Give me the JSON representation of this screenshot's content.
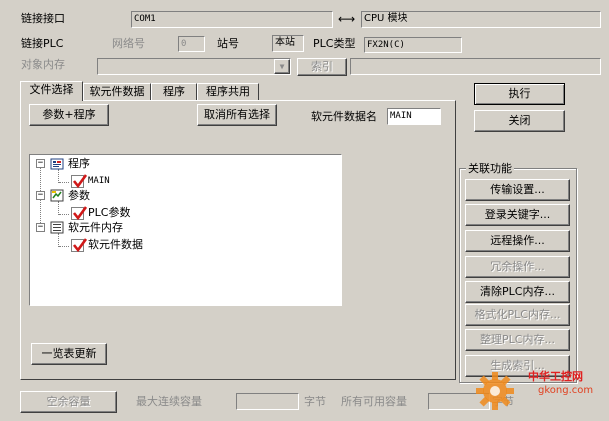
{
  "link": {
    "port_label": "链接接口",
    "port_value": "COM1",
    "arrow": "⟷",
    "target_value": "CPU 模块",
    "plc_label": "链接PLC",
    "network_label": "网络号",
    "network_value": "0",
    "station_label": "站号",
    "station_value": "本站",
    "plc_type_label": "PLC类型",
    "plc_type_value": "FX2N(C)",
    "object_mem_label": "对象内存",
    "index_button": "索引"
  },
  "tabs": [
    {
      "label": "文件选择"
    },
    {
      "label": "软元件数据"
    },
    {
      "label": "程序"
    },
    {
      "label": "程序共用"
    }
  ],
  "file_select": {
    "param_program_button": "参数+程序",
    "cancel_all_button": "取消所有选择",
    "device_name_label": "软元件数据名",
    "device_name_value": "MAIN",
    "tree": {
      "program": {
        "label": "程序",
        "children": [
          "MAIN"
        ]
      },
      "parameter": {
        "label": "参数",
        "children": [
          "PLC参数"
        ]
      },
      "device_memory": {
        "label": "软元件内存",
        "children": [
          "软元件数据"
        ]
      }
    },
    "refresh_button": "一览表更新"
  },
  "actions": {
    "execute": "执行",
    "close": "关闭"
  },
  "related": {
    "title": "关联功能",
    "buttons": [
      {
        "label": "传输设置...",
        "enabled": true
      },
      {
        "label": "登录关键字...",
        "enabled": true
      },
      {
        "label": "远程操作...",
        "enabled": true
      },
      {
        "label": "冗余操作...",
        "enabled": false
      },
      {
        "label": "清除PLC内存...",
        "enabled": true
      },
      {
        "label": "格式化PLC内存...",
        "enabled": false
      },
      {
        "label": "整理PLC内存...",
        "enabled": false
      },
      {
        "label": "生成索引...",
        "enabled": false
      }
    ]
  },
  "capacity": {
    "free_button": "空余容量",
    "max_continuous_label": "最大连续容量",
    "bytes_unit": "字节",
    "all_available_label": "所有可用容量",
    "bytes_unit_2": "字节"
  },
  "watermark": {
    "text": "中华工控网",
    "url": "gkong.com"
  },
  "colors": {
    "window_bg": "#d4d0c8",
    "check_red": "#d01818",
    "watermark_orange": "#f08a1c",
    "watermark_red": "#e02020"
  }
}
